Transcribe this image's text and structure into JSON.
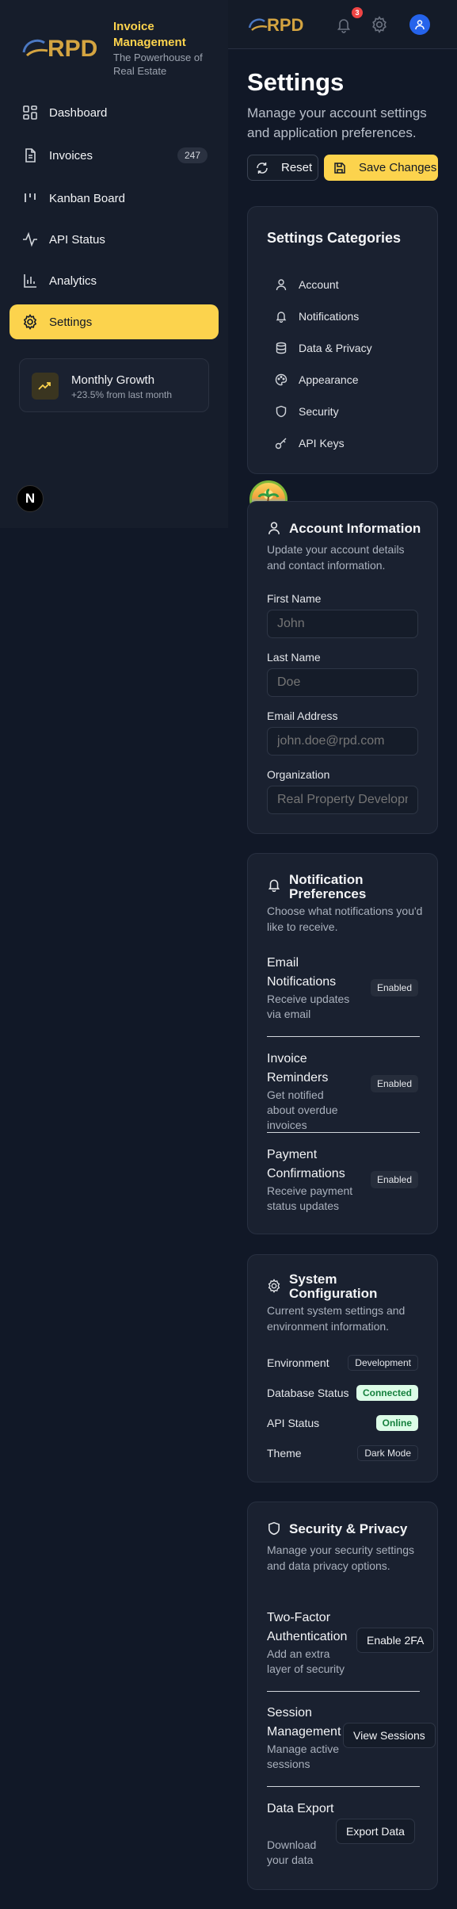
{
  "brand": {
    "logo_text": "RPD",
    "title": "Invoice Management",
    "subtitle": "The Powerhouse of Real Estate"
  },
  "sidebar": {
    "items": [
      {
        "label": "Dashboard",
        "icon": "dashboard-icon"
      },
      {
        "label": "Invoices",
        "icon": "file-text-icon",
        "badge": "247"
      },
      {
        "label": "Kanban Board",
        "icon": "kanban-icon"
      },
      {
        "label": "API Status",
        "icon": "activity-icon"
      },
      {
        "label": "Analytics",
        "icon": "bar-chart-icon"
      },
      {
        "label": "Settings",
        "icon": "gear-icon",
        "active": true
      }
    ],
    "growth": {
      "title": "Monthly Growth",
      "subtitle": "+23.5% from last month",
      "icon": "trending-up-icon"
    },
    "next_badge": "N"
  },
  "topbar": {
    "notification_count": "3"
  },
  "page": {
    "title": "Settings",
    "subtitle": "Manage your account settings and application preferences.",
    "reset_label": "Reset",
    "save_label": "Save Changes"
  },
  "categories": {
    "title": "Settings Categories",
    "items": [
      {
        "label": "Account",
        "icon": "user-icon"
      },
      {
        "label": "Notifications",
        "icon": "bell-icon"
      },
      {
        "label": "Data & Privacy",
        "icon": "database-icon"
      },
      {
        "label": "Appearance",
        "icon": "palette-icon"
      },
      {
        "label": "Security",
        "icon": "shield-icon"
      },
      {
        "label": "API Keys",
        "icon": "key-icon"
      }
    ]
  },
  "account": {
    "title": "Account Information",
    "description": "Update your account details and contact information.",
    "fields": [
      {
        "label": "First Name",
        "placeholder": "John"
      },
      {
        "label": "Last Name",
        "placeholder": "Doe"
      },
      {
        "label": "Email Address",
        "placeholder": "john.doe@rpd.com"
      },
      {
        "label": "Organization",
        "placeholder": "Real Property Development"
      }
    ]
  },
  "notifications": {
    "title": "Notification Preferences",
    "description": "Choose what notifications you'd like to receive.",
    "items": [
      {
        "title": "Email Notifications",
        "description": "Receive updates via email",
        "status": "Enabled"
      },
      {
        "title": "Invoice Reminders",
        "description": "Get notified about overdue invoices",
        "status": "Enabled"
      },
      {
        "title": "Payment Confirmations",
        "description": "Receive payment status updates",
        "status": "Enabled"
      }
    ]
  },
  "system": {
    "title": "System Configuration",
    "description": "Current system settings and environment information.",
    "rows": [
      {
        "label": "Environment",
        "value": "Development",
        "style": "neutral"
      },
      {
        "label": "Database Status",
        "value": "Connected",
        "style": "green"
      },
      {
        "label": "API Status",
        "value": "Online",
        "style": "green"
      },
      {
        "label": "Theme",
        "value": "Dark Mode",
        "style": "neutral"
      }
    ]
  },
  "security": {
    "title": "Security & Privacy",
    "description": "Manage your security settings and data privacy options.",
    "items": [
      {
        "title": "Two-Factor Authentication",
        "description": "Add an extra layer of security",
        "action": "Enable 2FA"
      },
      {
        "title": "Session Management",
        "description": "Manage active sessions",
        "action": "View Sessions"
      },
      {
        "title": "Data Export",
        "description": "Download your data",
        "action": "Export Data"
      }
    ]
  },
  "colors": {
    "accent": "#fcd34d",
    "background": "#111827",
    "card": "#1a2130",
    "success_bg": "#dcfce7",
    "success_text": "#15803d",
    "notification": "#ef4444",
    "avatar": "#2563eb"
  }
}
